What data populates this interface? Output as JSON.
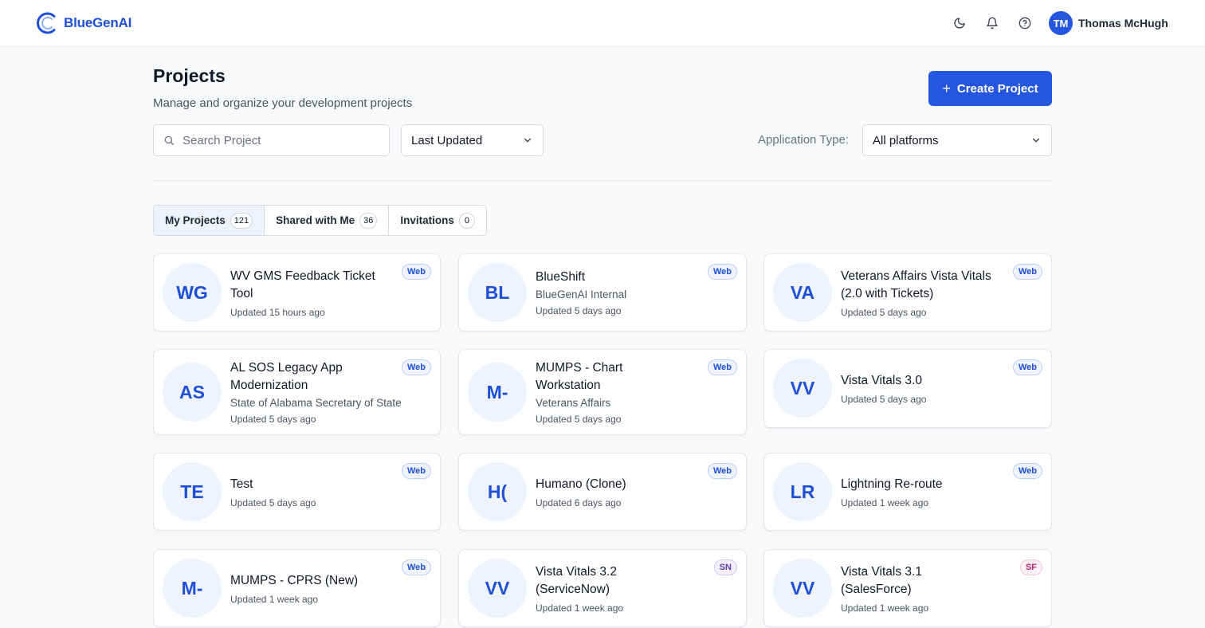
{
  "app": {
    "name": "BlueGenAI",
    "brand_color": "#2556e0"
  },
  "header": {
    "icons": [
      "moon-icon",
      "bell-icon",
      "help-icon"
    ],
    "user": {
      "initials": "TM",
      "name": "Thomas McHugh"
    }
  },
  "page": {
    "title": "Projects",
    "subtitle": "Manage and organize your development projects",
    "create_label": "Create Project"
  },
  "filters": {
    "search_placeholder": "Search Project",
    "search_value": "",
    "sort_value": "Last Updated",
    "app_type_label": "Application Type:",
    "platform_value": "All platforms"
  },
  "tabs": [
    {
      "label": "My Projects",
      "count": "121",
      "active": true
    },
    {
      "label": "Shared with Me",
      "count": "36",
      "active": false
    },
    {
      "label": "Invitations",
      "count": "0",
      "active": false
    }
  ],
  "badge_styles": {
    "Web": {
      "text": "#1e4fd8",
      "bg": "#eef3fd",
      "border": "#bcd0f6"
    },
    "SN": {
      "text": "#5b3fa6",
      "bg": "#f3effc",
      "border": "#d4c8f0"
    },
    "SF": {
      "text": "#c0266d",
      "bg": "#fdf0f6",
      "border": "#f3c5da"
    }
  },
  "projects": [
    {
      "initials": "WG",
      "name": "WV GMS Feedback Ticket Tool",
      "org": "",
      "updated": "Updated 15 hours ago",
      "badge": "Web"
    },
    {
      "initials": "BL",
      "name": "BlueShift",
      "org": "BlueGenAI Internal",
      "updated": "Updated 5 days ago",
      "badge": "Web"
    },
    {
      "initials": "VA",
      "name": "Veterans Affairs Vista Vitals (2.0 with Tickets)",
      "org": "",
      "updated": "Updated 5 days ago",
      "badge": "Web"
    },
    {
      "initials": "AS",
      "name": "AL SOS Legacy App Modernization",
      "org": "State of Alabama Secretary of State",
      "updated": "Updated 5 days ago",
      "badge": "Web"
    },
    {
      "initials": "M-",
      "name": "MUMPS - Chart Workstation",
      "org": "Veterans Affairs",
      "updated": "Updated 5 days ago",
      "badge": "Web"
    },
    {
      "initials": "VV",
      "name": "Vista Vitals 3.0",
      "org": "",
      "updated": "Updated 5 days ago",
      "badge": "Web"
    },
    {
      "initials": "TE",
      "name": "Test",
      "org": "",
      "updated": "Updated 5 days ago",
      "badge": "Web"
    },
    {
      "initials": "H(",
      "name": "Humano (Clone)",
      "org": "",
      "updated": "Updated 6 days ago",
      "badge": "Web"
    },
    {
      "initials": "LR",
      "name": "Lightning Re-route",
      "org": "",
      "updated": "Updated 1 week ago",
      "badge": "Web"
    },
    {
      "initials": "M-",
      "name": "MUMPS - CPRS (New)",
      "org": "",
      "updated": "Updated 1 week ago",
      "badge": "Web"
    },
    {
      "initials": "VV",
      "name": "Vista Vitals 3.2 (ServiceNow)",
      "org": "",
      "updated": "Updated 1 week ago",
      "badge": "SN"
    },
    {
      "initials": "VV",
      "name": "Vista Vitals 3.1 (SalesForce)",
      "org": "",
      "updated": "Updated 1 week ago",
      "badge": "SF"
    }
  ]
}
